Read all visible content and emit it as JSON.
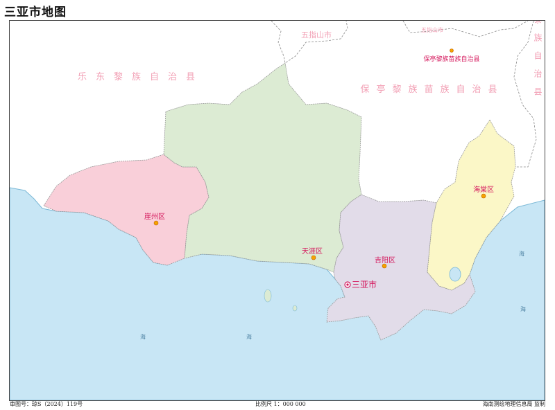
{
  "title": "三亚市地图",
  "footer": {
    "approval": "审图号：琼S（2024）119号",
    "scale": "比例尺 1：000 000",
    "publisher": "海南测绘地理信息局 监制"
  },
  "districts": [
    {
      "name": "崖州区",
      "color": "#f9cfd9"
    },
    {
      "name": "天涯区",
      "color": "#dcebd3"
    },
    {
      "name": "吉阳区",
      "color": "#e2dce9"
    },
    {
      "name": "海棠区",
      "color": "#fbf7c7"
    }
  ],
  "city": {
    "name": "三亚市"
  },
  "neighbors": {
    "ledong": "乐东黎族自治县",
    "baoting": "保亭黎族苗族自治县",
    "baoting_seat": "保亭黎族苗族自治县",
    "wuzhishan": "五指山市",
    "wuzhishan_small": "五指山市",
    "lingshui": "陵水黎族自治县"
  },
  "sea_label": "海",
  "colors": {
    "sea": "#c8e6f5",
    "coast": "#7ab8d6",
    "label_pink": "#f2a0b5",
    "label_red": "#d4145a",
    "marker": "#f5a300",
    "border": "#888888"
  }
}
